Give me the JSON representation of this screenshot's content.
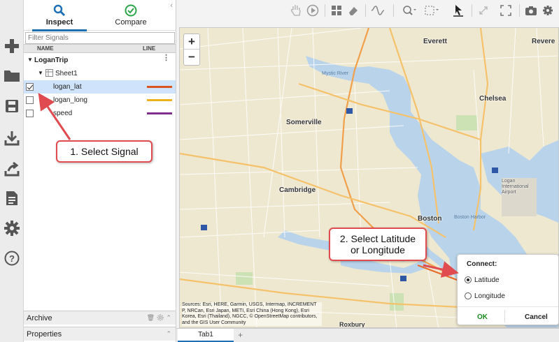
{
  "panel": {
    "tabs": [
      {
        "label": "Inspect"
      },
      {
        "label": "Compare"
      }
    ],
    "filter_placeholder": "Filter Signals",
    "columns": {
      "name": "NAME",
      "line": "LINE"
    },
    "run": "LoganTrip",
    "sheet": "Sheet1",
    "signals": [
      {
        "name": "logan_lat",
        "checked": true,
        "color": "#d9541e"
      },
      {
        "name": "logan_long",
        "checked": false,
        "color": "#edb120"
      },
      {
        "name": "speed",
        "checked": false,
        "color": "#7e2f8e"
      }
    ],
    "archive": "Archive",
    "properties": "Properties"
  },
  "map": {
    "labels": {
      "everett": "Everett",
      "revere": "Revere",
      "chelsea": "Chelsea",
      "somerville": "Somerville",
      "cambridge": "Cambridge",
      "boston": "Boston",
      "roxbury": "Roxbury",
      "mystic_river": "Mystic River",
      "boston_harbor": "Boston Harbor",
      "logan_airport": "Logan International Airport"
    },
    "attribution": "Sources: Esri, HERE, Garmin, USGS, Intermap, INCREMENT P, NRCan, Esri Japan, METI, Esri China (Hong Kong), Esri Korea, Esri (Thailand), NGCC, © OpenStreetMap contributors, and the GIS User Community"
  },
  "connect": {
    "title": "Connect:",
    "options": [
      {
        "label": "Latitude",
        "selected": true
      },
      {
        "label": "Longitude",
        "selected": false
      }
    ],
    "ok": "OK",
    "cancel": "Cancel"
  },
  "callouts": {
    "select_signal": "1. Select Signal",
    "select_latlon_line1": "2. Select Latitude",
    "select_latlon_line2": "or Longitude"
  },
  "tabstrip": {
    "tab": "Tab1",
    "add": "+"
  },
  "colors": {
    "accent": "#1f6fb5",
    "callout_red": "#e04b50",
    "ok_green": "#1d8a22"
  }
}
